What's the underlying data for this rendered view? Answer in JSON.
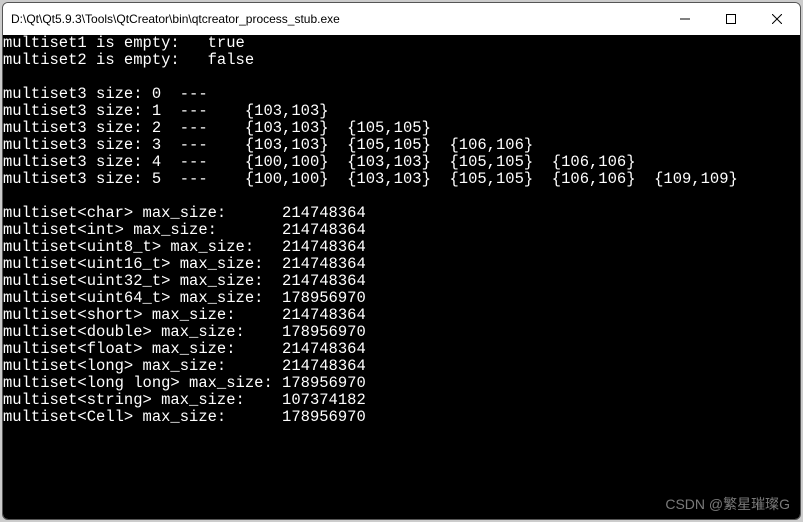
{
  "window": {
    "title": "D:\\Qt\\Qt5.9.3\\Tools\\QtCreator\\bin\\qtcreator_process_stub.exe",
    "buttons": {
      "min": "min",
      "max": "max",
      "close": "close"
    }
  },
  "console": {
    "empty_checks": [
      {
        "label": "multiset1 is empty:",
        "value": "true"
      },
      {
        "label": "multiset2 is empty:",
        "value": "false"
      }
    ],
    "size_lines": [
      {
        "label": "multiset3 size:",
        "size": "0",
        "sep": "---",
        "sets": []
      },
      {
        "label": "multiset3 size:",
        "size": "1",
        "sep": "---",
        "sets": [
          "{103,103}"
        ]
      },
      {
        "label": "multiset3 size:",
        "size": "2",
        "sep": "---",
        "sets": [
          "{103,103}",
          "{105,105}"
        ]
      },
      {
        "label": "multiset3 size:",
        "size": "3",
        "sep": "---",
        "sets": [
          "{103,103}",
          "{105,105}",
          "{106,106}"
        ]
      },
      {
        "label": "multiset3 size:",
        "size": "4",
        "sep": "---",
        "sets": [
          "{100,100}",
          "{103,103}",
          "{105,105}",
          "{106,106}"
        ]
      },
      {
        "label": "multiset3 size:",
        "size": "5",
        "sep": "---",
        "sets": [
          "{100,100}",
          "{103,103}",
          "{105,105}",
          "{106,106}",
          "{109,109}"
        ]
      }
    ],
    "maxsize_lines": [
      {
        "label": "multiset<char> max_size:",
        "value": "214748364"
      },
      {
        "label": "multiset<int> max_size:",
        "value": "214748364"
      },
      {
        "label": "multiset<uint8_t> max_size:",
        "value": "214748364"
      },
      {
        "label": "multiset<uint16_t> max_size:",
        "value": "214748364"
      },
      {
        "label": "multiset<uint32_t> max_size:",
        "value": "214748364"
      },
      {
        "label": "multiset<uint64_t> max_size:",
        "value": "178956970"
      },
      {
        "label": "multiset<short> max_size:",
        "value": "214748364"
      },
      {
        "label": "multiset<double> max_size:",
        "value": "178956970"
      },
      {
        "label": "multiset<float> max_size:",
        "value": "214748364"
      },
      {
        "label": "multiset<long> max_size:",
        "value": "214748364"
      },
      {
        "label": "multiset<long long> max_size:",
        "value": "178956970"
      },
      {
        "label": "multiset<string> max_size:",
        "value": "107374182"
      },
      {
        "label": "multiset<Cell> max_size:",
        "value": "178956970"
      }
    ]
  },
  "watermark": "CSDN @繁星璀璨G"
}
